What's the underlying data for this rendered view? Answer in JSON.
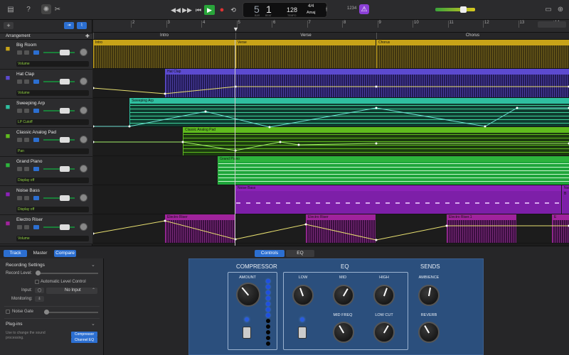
{
  "toolbar": {
    "lcd_bar": "5",
    "lcd_beat": "1",
    "lcd_bar_label": "BAR",
    "lcd_beat_label": "BEAT",
    "lcd_tempo": "128",
    "lcd_tempo_label": "TEMPO",
    "lcd_sig": "4/4",
    "lcd_key": "Amaj",
    "count_in": "1234"
  },
  "arrangement": {
    "title": "Arrangement",
    "markers": [
      "Intro",
      "Verse",
      "Chorus"
    ]
  },
  "ruler": {
    "bars": [
      "2",
      "3",
      "4",
      "5",
      "6",
      "7",
      "8",
      "9",
      "10",
      "11",
      "12",
      "13",
      "14"
    ]
  },
  "tracks": [
    {
      "name": "Big Room",
      "automation": "Volume",
      "color": "#c8a318",
      "icon": "drum-machine-icon"
    },
    {
      "name": "Hat Clap",
      "automation": "Volume",
      "color": "#5c4ad0",
      "icon": "drum-icon"
    },
    {
      "name": "Sweeping Arp",
      "automation": "LP Cutoff",
      "color": "#2fbfa0",
      "icon": "synth-icon"
    },
    {
      "name": "Classic Analog Pad",
      "automation": "Pan",
      "color": "#5fbb1e",
      "icon": "keyboard-icon"
    },
    {
      "name": "Grand Piano",
      "automation": "Display off",
      "color": "#2db43d",
      "icon": "piano-icon"
    },
    {
      "name": "Noise Bass",
      "automation": "Display off",
      "color": "#8c22b8",
      "icon": "synth-bass-icon"
    },
    {
      "name": "Electro Riser",
      "automation": "Volume",
      "color": "#a0239c",
      "icon": "riser-icon"
    }
  ],
  "regions": {
    "intro": "Intro",
    "verse": "Verse",
    "chorus": "Chorus",
    "hat_clap": "Hat Clap",
    "sweeping_arp": "Sweeping Arp",
    "classic_pad": "Classic Analog Pad",
    "grand_piano": "Grand Piano",
    "noise_bass": "Noise Bass",
    "noise_bass_short": "Noise B",
    "electro_riser": "Electro Riser",
    "electro_riser_1": "Electro Riser.1",
    "electro_riser_e": "E"
  },
  "bottom_tabs": {
    "track": "Track",
    "master": "Master",
    "compare": "Compare",
    "controls": "Controls",
    "eq": "EQ"
  },
  "left_panel": {
    "recording_settings": "Recording Settings",
    "record_level": "Record Level:",
    "auto_level": "Automatic Level Control",
    "input": "Input:",
    "input_value": "No Input",
    "monitoring": "Monitoring:",
    "noise_gate": "Noise Gate",
    "plugins": "Plug-ins",
    "plugins_hint": "Use to change the sound processing.",
    "plugin_1": "Compressor",
    "plugin_2": "Channel EQ"
  },
  "plugin": {
    "compressor": "COMPRESSOR",
    "amount": "AMOUNT",
    "eq": "EQ",
    "low": "LOW",
    "mid": "MID",
    "high": "HIGH",
    "mid_freq": "MID FREQ",
    "low_cut": "LOW CUT",
    "sends": "SENDS",
    "ambience": "AMBIENCE",
    "reverb": "REVERB"
  },
  "colors": {
    "accent_blue": "#2c6fd1",
    "play_green": "#29a53a",
    "record_red": "#d33",
    "plugin_bg": "#2b4f7d"
  }
}
